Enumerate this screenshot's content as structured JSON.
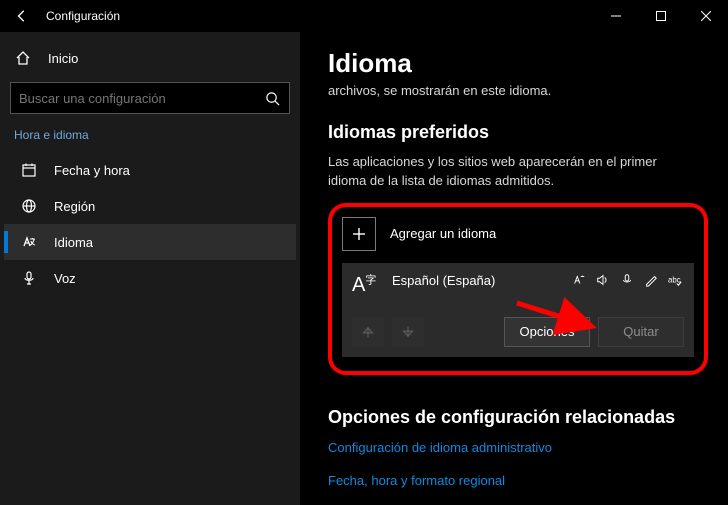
{
  "titlebar": {
    "title": "Configuración"
  },
  "sidebar": {
    "home": "Inicio",
    "search_placeholder": "Buscar una configuración",
    "section": "Hora e idioma",
    "items": [
      {
        "label": "Fecha y hora"
      },
      {
        "label": "Región"
      },
      {
        "label": "Idioma"
      },
      {
        "label": "Voz"
      }
    ]
  },
  "main": {
    "title": "Idioma",
    "truncated": "archivos, se mostrarán en este idioma.",
    "preferred_heading": "Idiomas preferidos",
    "preferred_desc": "Las aplicaciones y los sitios web aparecerán en el primer idioma de la lista de idiomas admitidos.",
    "add_label": "Agregar un idioma",
    "lang_name": "Español (España)",
    "options_btn": "Opciones",
    "remove_btn": "Quitar",
    "related_heading": "Opciones de configuración relacionadas",
    "link1": "Configuración de idioma administrativo",
    "link2": "Fecha, hora y formato regional"
  }
}
